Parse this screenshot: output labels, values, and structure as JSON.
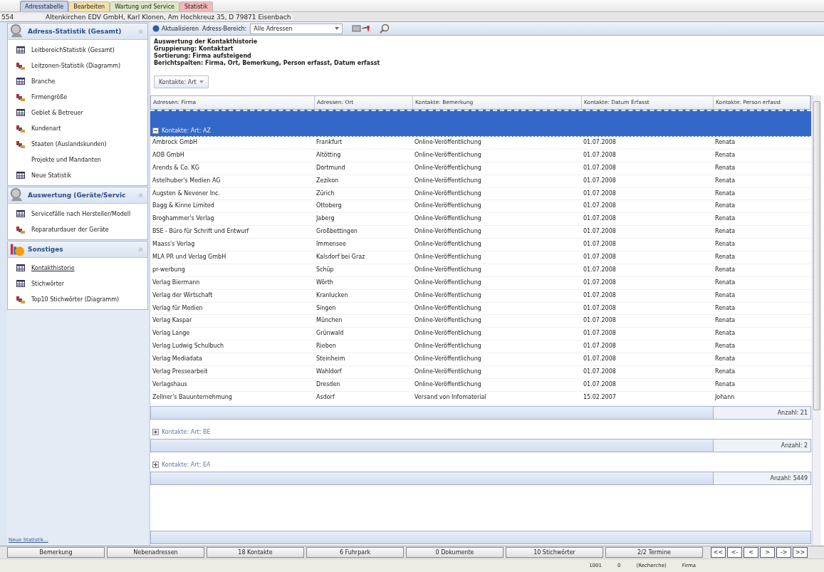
{
  "tabs": [
    {
      "label": "Adresstabelle",
      "color": "#c9d3ee",
      "selected": true
    },
    {
      "label": "Bearbeiten",
      "color": "#f5dfa8",
      "selected": false
    },
    {
      "label": "Wartung und Service",
      "color": "#dde8c4",
      "selected": false
    },
    {
      "label": "Statistik",
      "color": "#f3b9b9",
      "selected": false
    }
  ],
  "address_bar": {
    "number": "554",
    "address": "Altenkirchen EDV GmbH, Karl Klonen, Am Hochkreuz 35, D 79871 Eisenbach"
  },
  "sidebar": {
    "sections": [
      {
        "title": "Adress-Statistik (Gesamt)",
        "kind": "search",
        "expanded": true,
        "items": [
          {
            "label": "LeitbereichStatistik (Gesamt)",
            "kind": "table",
            "selected": false
          },
          {
            "label": "Leitzonen-Statistik (Diagramm)",
            "kind": "chart",
            "selected": false
          },
          {
            "label": "Branche",
            "kind": "table",
            "selected": false
          },
          {
            "label": "Firmengröße",
            "kind": "chart",
            "selected": false
          },
          {
            "label": "Gebiet & Betreuer",
            "kind": "table",
            "selected": false
          },
          {
            "label": "Kundenart",
            "kind": "chart",
            "selected": false
          },
          {
            "label": "Staaten (Auslandskunden)",
            "kind": "chart",
            "selected": false
          },
          {
            "label": "Projekte und Mandanten",
            "kind": "none",
            "selected": false
          },
          {
            "label": "Neue Statistik",
            "kind": "table",
            "selected": false
          }
        ]
      },
      {
        "title": "Auswertung (Geräte/Servic",
        "kind": "search",
        "expanded": true,
        "items": [
          {
            "label": "Servicefälle nach Hersteller/Modell",
            "kind": "table",
            "selected": false
          },
          {
            "label": "Reparaturdauer der Geräte",
            "kind": "chart",
            "selected": false
          }
        ]
      },
      {
        "title": "Sonstiges",
        "kind": "pie",
        "expanded": true,
        "items": [
          {
            "label": "Kontakthistorie",
            "kind": "table",
            "selected": true
          },
          {
            "label": "Stichwörter",
            "kind": "table",
            "selected": false
          },
          {
            "label": "Top10 Stichwörter (Diagramm)",
            "kind": "chart",
            "selected": false
          }
        ]
      }
    ],
    "footer_link": "Neue Statistik..."
  },
  "toolbar": {
    "refresh": "Aktualisieren",
    "range_label": "Adress-Bereich:",
    "range_value": "Alle Adressen"
  },
  "report_header": [
    "Auswertung der Kontakthistorie",
    "Gruppierung: Kontaktart",
    "Sortierung: Firma aufsteigend",
    "Berichtspalten: Firma, Ort, Bemerkung, Person erfasst, Datum erfasst"
  ],
  "group_chip": "Kontakte: Art",
  "table": {
    "columns": [
      "Adressen: Firma",
      "Adressen: Ort",
      "Kontakte: Bemerkung",
      "Kontakte: Datum Erfasst",
      "Kontakte: Person erfasst"
    ],
    "groups": [
      {
        "label": "Kontakte: Art: AZ",
        "expanded": true,
        "selected": true,
        "count": "Anzahl: 21",
        "rows": [
          [
            "Ambrock GmbH",
            "Frankfurt",
            "Online-Veröffentlichung",
            "01.07.2008",
            "Renata"
          ],
          [
            "AOB GmbH",
            "Altötting",
            "Online-Veröffentlichung",
            "01.07.2008",
            "Renata"
          ],
          [
            "Arends & Co. KG",
            "Dortmund",
            "Online-Veröffentlichung",
            "01.07.2008",
            "Renata"
          ],
          [
            "Astelhuber's Medien AG",
            "Zezikon",
            "Online-Veröffentlichung",
            "01.07.2008",
            "Renata"
          ],
          [
            "Augsten & Nevener Inc.",
            "Zürich",
            "Online-Veröffentlichung",
            "01.07.2008",
            "Renata"
          ],
          [
            "Bagg & Kinne Limited",
            "Ottoberg",
            "Online-Veröffentlichung",
            "01.07.2008",
            "Renata"
          ],
          [
            "Broghammer's Verlag",
            "Jaberg",
            "Online-Veröffentlichung",
            "01.07.2008",
            "Renata"
          ],
          [
            "BSE - Büro für Schrift und Entwurf",
            "Großbettingen",
            "Online-Veröffentlichung",
            "01.07.2008",
            "Renata"
          ],
          [
            "Maass's Verlag",
            "Immensee",
            "Online-Veröffentlichung",
            "01.07.2008",
            "Renata"
          ],
          [
            "MLA PR und Verlag GmbH",
            "Kalsdorf bei Graz",
            "Online-Veröffentlichung",
            "01.07.2008",
            "Renata"
          ],
          [
            "pr-werbung",
            "Schüp",
            "Online-Veröffentlichung",
            "01.07.2008",
            "Renata"
          ],
          [
            "Verlag Biermann",
            "Wörth",
            "Online-Veröffentlichung",
            "01.07.2008",
            "Renata"
          ],
          [
            "Verlag der Wirtschaft",
            "Kranlucken",
            "Online-Veröffentlichung",
            "01.07.2008",
            "Renata"
          ],
          [
            "Verlag für Medien",
            "Singen",
            "Online-Veröffentlichung",
            "01.07.2008",
            "Renata"
          ],
          [
            "Verlag Kaspar",
            "München",
            "Online-Veröffentlichung",
            "01.07.2008",
            "Renata"
          ],
          [
            "Verlag Lange",
            "Grünwald",
            "Online-Veröffentlichung",
            "01.07.2008",
            "Renata"
          ],
          [
            "Verlag Ludwig Schulbuch",
            "Rieben",
            "Online-Veröffentlichung",
            "01.07.2008",
            "Renata"
          ],
          [
            "Verlag Mediadata",
            "Steinheim",
            "Online-Veröffentlichung",
            "01.07.2008",
            "Renata"
          ],
          [
            "Verlag Pressearbeit",
            "Wahldorf",
            "Online-Veröffentlichung",
            "01.07.2008",
            "Renata"
          ],
          [
            "Verlagshaus",
            "Dresden",
            "Online-Veröffentlichung",
            "01.07.2008",
            "Renata"
          ],
          [
            "Zellner's Bauunternehmung",
            "Asdorf",
            "Versand von Infomaterial",
            "15.02.2007",
            "Johann"
          ]
        ]
      },
      {
        "label": "Kontakte: Art: BE",
        "expanded": false,
        "selected": false,
        "count": "Anzahl: 2"
      },
      {
        "label": "Kontakte: Art: EA",
        "expanded": false,
        "selected": false,
        "count": "Anzahl: 5449"
      }
    ]
  },
  "bottom_buttons": [
    "Bemerkung",
    "Nebenadressen",
    "18 Kontakte",
    "6 Fuhrpark",
    "0 Dokumente",
    "10 Stichwörter",
    "2/2 Termine"
  ],
  "nav_buttons": [
    "<<",
    "<-",
    "<",
    ">",
    "->",
    ">>"
  ],
  "status_bar": [
    "1001",
    "0",
    "(Recherche)",
    "Firma"
  ]
}
